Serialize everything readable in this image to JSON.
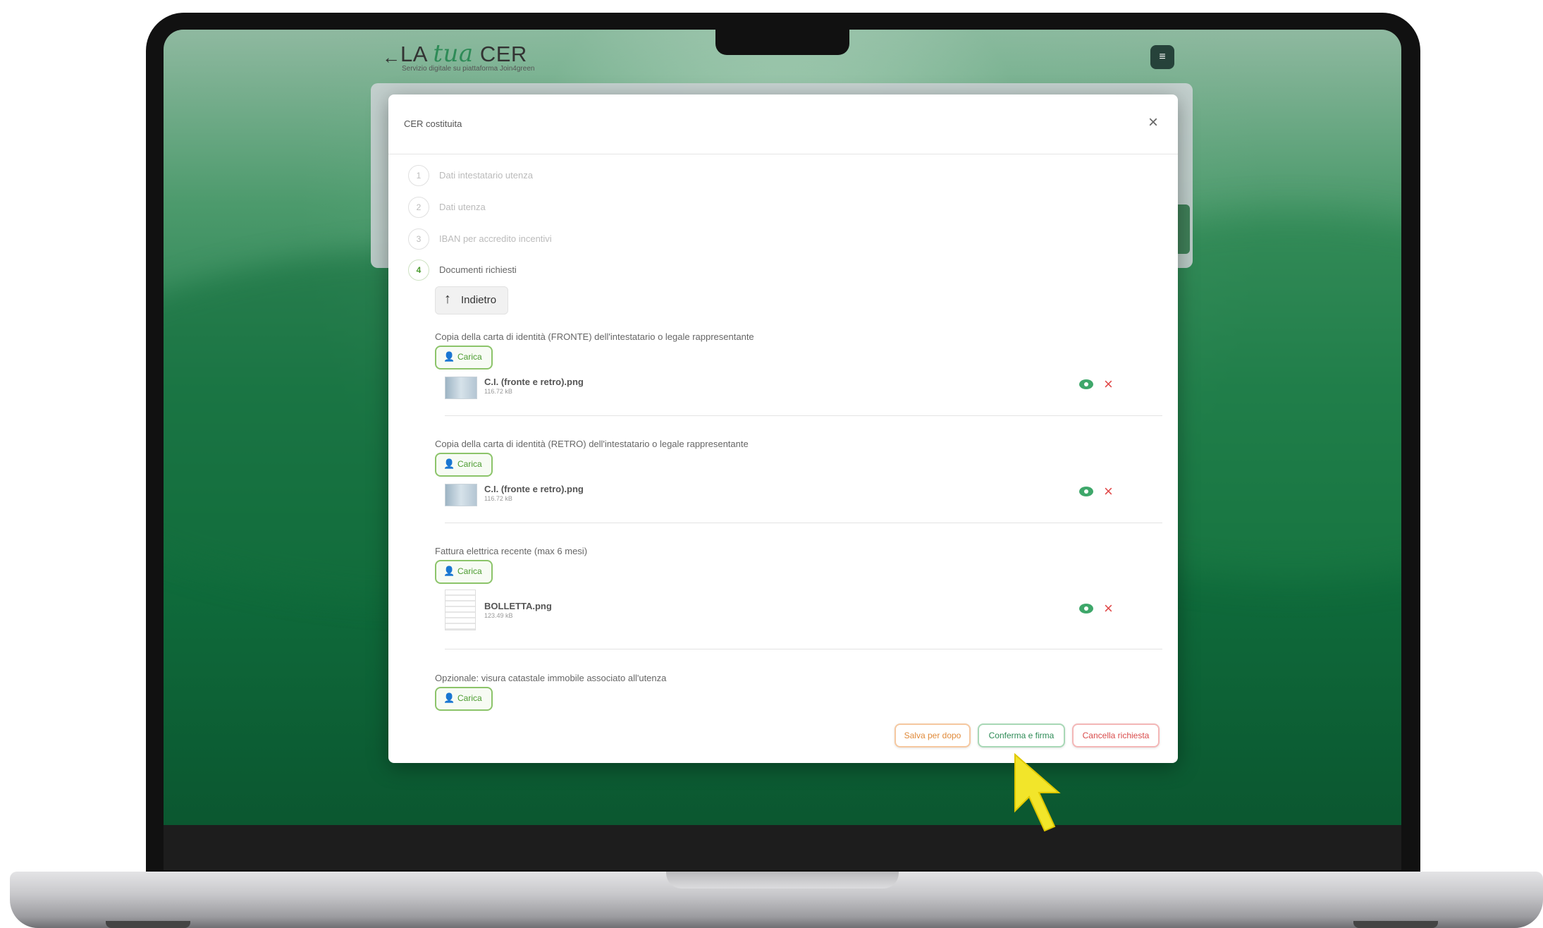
{
  "header": {
    "back_icon": "←",
    "logo_prefix": "LA",
    "logo_tua": "tua",
    "logo_suffix": "CER",
    "logo_sub": "Servizio digitale su piattaforma Join4green",
    "menu_icon": "≡"
  },
  "modal": {
    "title": "CER costituita",
    "close_icon": "×",
    "steps": [
      {
        "num": "1",
        "label": "Dati intestatario utenza"
      },
      {
        "num": "2",
        "label": "Dati utenza"
      },
      {
        "num": "3",
        "label": "IBAN per accredito incentivi"
      },
      {
        "num": "4",
        "label": "Documenti richiesti"
      }
    ],
    "back_button": {
      "icon": "↑",
      "label": "Indietro"
    },
    "upload_icon": "👤",
    "upload_label": "Carica",
    "documents": [
      {
        "title": "Copia della carta di identità (FRONTE) dell'intestatario o legale rappresentante",
        "file": {
          "name": "C.I. (fronte e retro).png",
          "size": "116.72 kB"
        }
      },
      {
        "title": "Copia della carta di identità (RETRO) dell'intestatario o legale rappresentante",
        "file": {
          "name": "C.I. (fronte e retro).png",
          "size": "116.72 kB"
        }
      },
      {
        "title": "Fattura elettrica recente (max 6 mesi)",
        "file": {
          "name": "BOLLETTA.png",
          "size": "123.49 kB"
        }
      },
      {
        "title": "Opzionale: visura catastale immobile associato all'utenza"
      }
    ],
    "remove_icon": "×",
    "footer": {
      "save_label": "Salva per dopo",
      "confirm_label": "Conferma e firma",
      "cancel_label": "Cancella richiesta"
    }
  },
  "colors": {
    "accent_green": "#4b9b2f",
    "save_orange": "#e08a3a",
    "cancel_red": "#d94b4b",
    "cursor_yellow": "#f2e52a"
  }
}
